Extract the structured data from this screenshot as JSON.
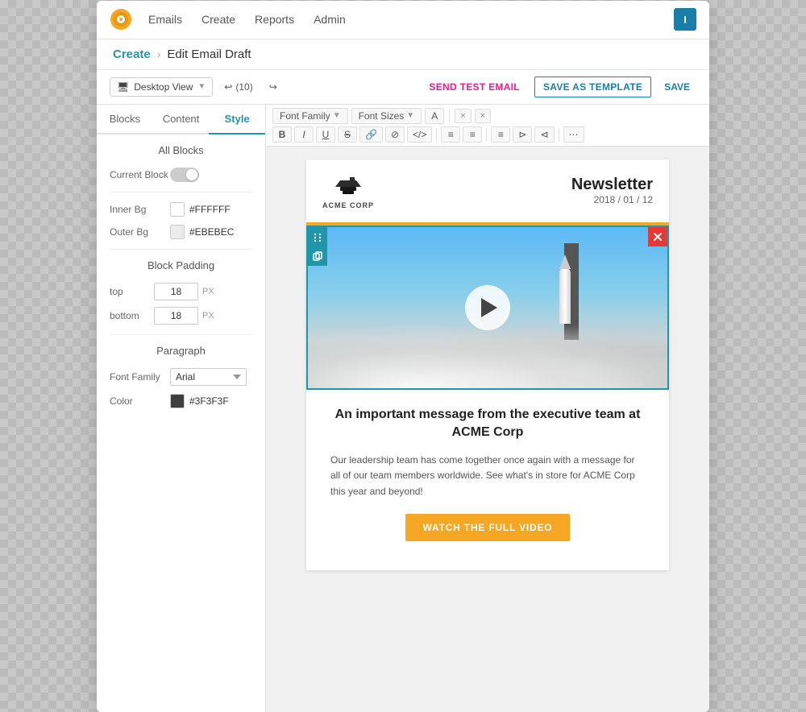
{
  "app": {
    "logo_initial": "⚙",
    "user_initial": "I"
  },
  "nav": {
    "emails": "Emails",
    "create": "Create",
    "reports": "Reports",
    "admin": "Admin"
  },
  "breadcrumb": {
    "create": "Create",
    "separator": "›",
    "current": "Edit Email Draft"
  },
  "toolbar": {
    "view_label": "Desktop View",
    "undo_count": "(10)",
    "send_test": "SEND TEST EMAIL",
    "save_template": "SAVE AS TEMPLATE",
    "save": "SAVE"
  },
  "panel": {
    "tab_blocks": "Blocks",
    "tab_content": "Content",
    "tab_style": "Style",
    "all_blocks": "All Blocks",
    "current_block_label": "Current Block",
    "inner_bg_label": "Inner Bg",
    "inner_bg_value": "#FFFFFF",
    "inner_bg_color": "#FFFFFF",
    "outer_bg_label": "Outer Bg",
    "outer_bg_value": "#EBEBEC",
    "outer_bg_color": "#EBEBEC",
    "block_padding_title": "Block Padding",
    "top_label": "top",
    "top_value": "18",
    "bottom_label": "bottom",
    "bottom_value": "18",
    "px_label": "PX",
    "paragraph_title": "Paragraph",
    "font_family_label": "Font Family",
    "font_family_value": "Arial",
    "color_label": "Color",
    "color_swatch": "#3F3F3F",
    "color_value": "#3F3F3F"
  },
  "format": {
    "font_family": "Font Family",
    "font_sizes": "Font Sizes",
    "a_btn": "A",
    "close1": "×",
    "close2": "×",
    "bold": "B",
    "italic": "I",
    "underline": "U",
    "strikethrough": "S",
    "link": "🔗",
    "unlink": "⊘",
    "code": "</>",
    "list_ul": "≡",
    "list_ol": "≡",
    "align": "≡",
    "indent": "⊳",
    "outdent": "⊲"
  },
  "email": {
    "acme_name": "ACME CORP",
    "newsletter_title": "Newsletter",
    "date": "2018 / 01 / 12",
    "headline_line1": "An important message from the executive team at",
    "headline_line2": "ACME Corp",
    "body_text": "Our leadership team has come together once again with a message for all of our team members worldwide. See what's in store for ACME Corp this year and beyond!",
    "cta_label": "WaTCH The FULL Video"
  }
}
